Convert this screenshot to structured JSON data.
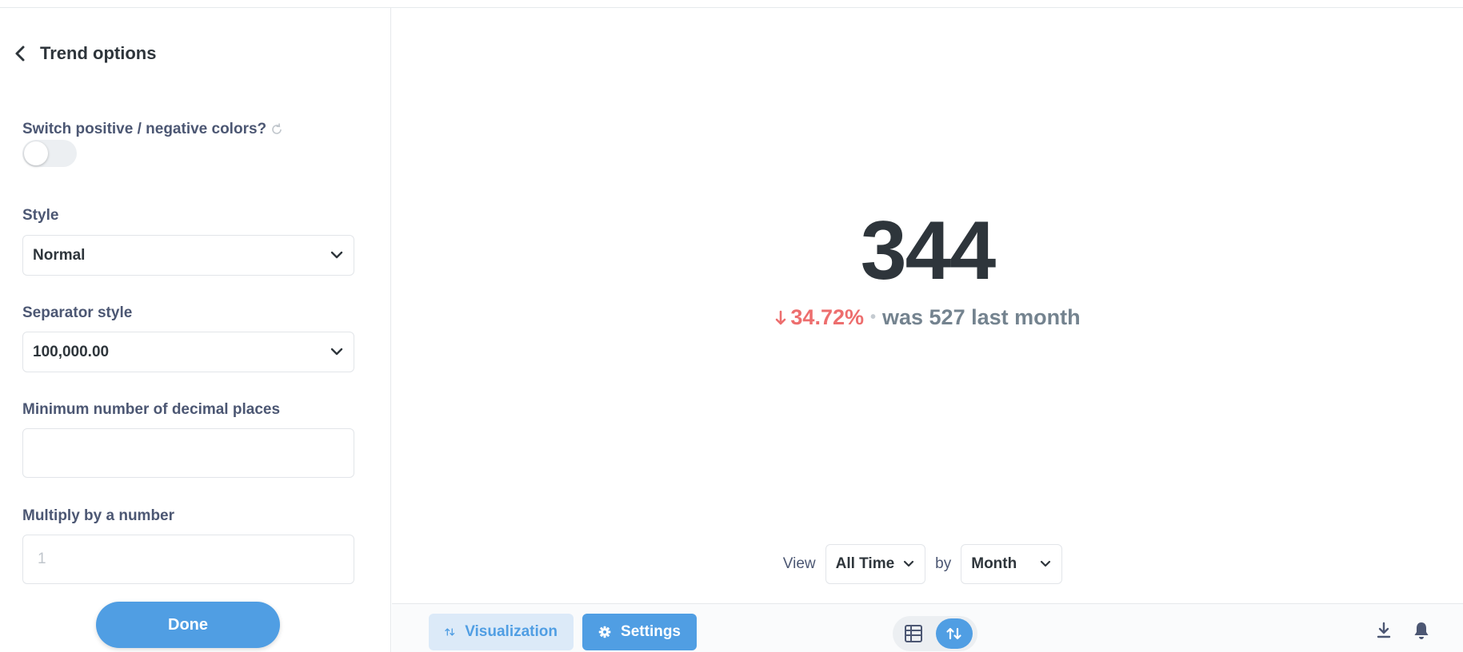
{
  "sidebar": {
    "title": "Trend options",
    "switch_colors": {
      "label": "Switch positive / negative colors?",
      "enabled": false
    },
    "style": {
      "label": "Style",
      "value": "Normal"
    },
    "separator": {
      "label": "Separator style",
      "value": "100,000.00"
    },
    "decimals": {
      "label": "Minimum number of decimal places",
      "value": "",
      "placeholder": ""
    },
    "multiply": {
      "label": "Multiply by a number",
      "value": "",
      "placeholder": "1"
    },
    "done_label": "Done"
  },
  "main": {
    "value": "344",
    "trend": {
      "direction": "down",
      "change": "34.72%",
      "separator": "•",
      "previous": "was 527 last month",
      "color": "#ed6e6e"
    },
    "view": {
      "view_label": "View",
      "period": "All Time",
      "by_label": "by",
      "granularity": "Month"
    }
  },
  "footer": {
    "visualization_label": "Visualization",
    "settings_label": "Settings",
    "accent": "#509ee3"
  }
}
